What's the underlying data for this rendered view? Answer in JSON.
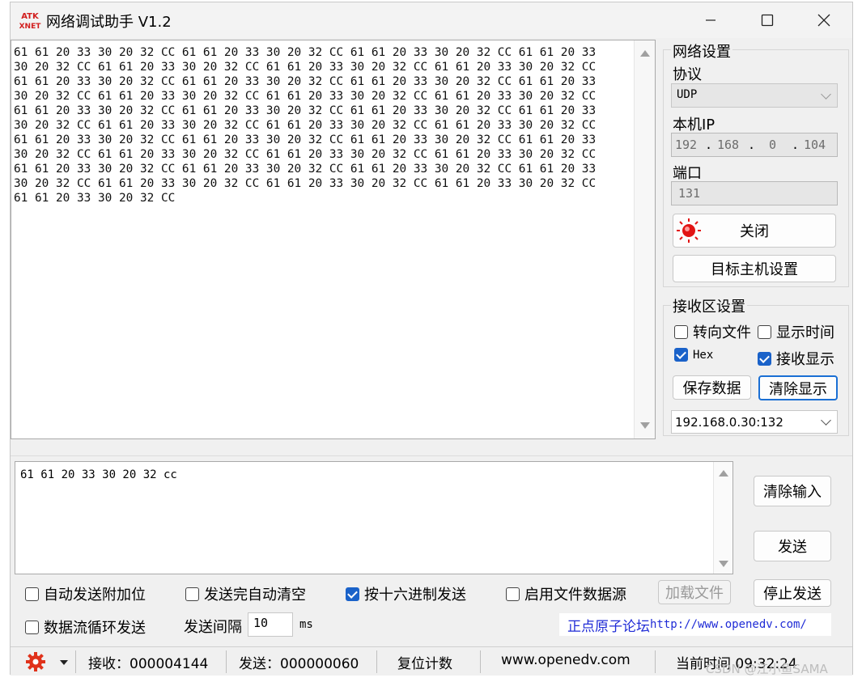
{
  "window": {
    "title": "网络调试助手 V1.2",
    "logo_text_top": "ATK",
    "logo_text_bottom": "XNET"
  },
  "receive": {
    "lines": [
      "61 61 20 33 30 20 32 CC 61 61 20 33 30 20 32 CC 61 61 20 33 30 20 32 CC 61 61 20 33",
      "30 20 32 CC 61 61 20 33 30 20 32 CC 61 61 20 33 30 20 32 CC 61 61 20 33 30 20 32 CC",
      "61 61 20 33 30 20 32 CC 61 61 20 33 30 20 32 CC 61 61 20 33 30 20 32 CC 61 61 20 33",
      "30 20 32 CC 61 61 20 33 30 20 32 CC 61 61 20 33 30 20 32 CC 61 61 20 33 30 20 32 CC",
      "61 61 20 33 30 20 32 CC 61 61 20 33 30 20 32 CC 61 61 20 33 30 20 32 CC 61 61 20 33",
      "30 20 32 CC 61 61 20 33 30 20 32 CC 61 61 20 33 30 20 32 CC 61 61 20 33 30 20 32 CC",
      "61 61 20 33 30 20 32 CC 61 61 20 33 30 20 32 CC 61 61 20 33 30 20 32 CC 61 61 20 33",
      "30 20 32 CC 61 61 20 33 30 20 32 CC 61 61 20 33 30 20 32 CC 61 61 20 33 30 20 32 CC",
      "61 61 20 33 30 20 32 CC 61 61 20 33 30 20 32 CC 61 61 20 33 30 20 32 CC 61 61 20 33",
      "30 20 32 CC 61 61 20 33 30 20 32 CC 61 61 20 33 30 20 32 CC 61 61 20 33 30 20 32 CC",
      "61 61 20 33 30 20 32 CC"
    ]
  },
  "network": {
    "group_title": "网络设置",
    "protocol_label": "协议",
    "protocol_value": "UDP",
    "ip_label": "本机IP",
    "ip_parts": [
      "192",
      "168",
      "0",
      "104"
    ],
    "port_label": "端口",
    "port_value": "131",
    "close_button": "关闭",
    "target_button": "目标主机设置"
  },
  "receive_settings": {
    "group_title": "接收区设置",
    "to_file": "转向文件",
    "show_time": "显示时间",
    "hex": "Hex",
    "show_recv": "接收显示",
    "save_button": "保存数据",
    "clear_button": "清除显示",
    "target_select": "192.168.0.30:132"
  },
  "send": {
    "text": "61 61 20 33 30 20 32 cc",
    "clear_input": "清除输入",
    "send_button": "发送",
    "stop_button": "停止发送",
    "auto_append": "自动发送附加位",
    "auto_clear": "发送完自动清空",
    "hex_send": "按十六进制发送",
    "file_source": "启用文件数据源",
    "load_file": "加载文件",
    "loop_send": "数据流循环发送",
    "interval_label": "发送间隔",
    "interval_value": "10",
    "interval_unit": "ms",
    "forum_label": "正点原子论坛",
    "forum_url": "http://www.openedv.com/"
  },
  "status": {
    "recv_label": "接收：",
    "recv_count": "000004144",
    "send_label": "发送：",
    "send_count": "000000060",
    "reset_button": "复位计数",
    "website": "www.openedv.com",
    "time_label": "当前时间",
    "time_value": "09:32:24"
  },
  "watermark": "CSDN @江小鱼SAMA",
  "colors": {
    "accent": "#1a62c9",
    "link": "#1f2bd6",
    "gear": "#e0321b"
  }
}
